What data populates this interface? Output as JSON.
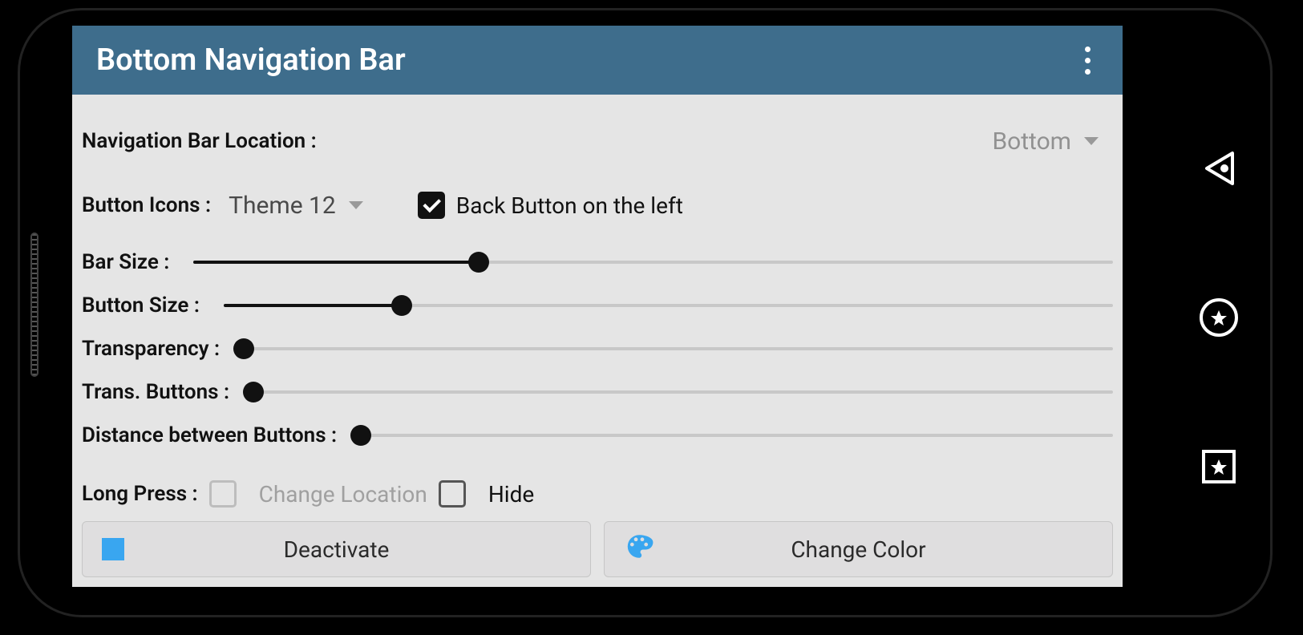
{
  "appBar": {
    "title": "Bottom Navigation Bar"
  },
  "navLocation": {
    "label": "Navigation Bar Location :",
    "value": "Bottom"
  },
  "buttonIcons": {
    "label": "Button Icons :",
    "theme": "Theme 12",
    "backLeftLabel": "Back Button on the left",
    "backLeftChecked": true
  },
  "sliders": {
    "barSize": {
      "label": "Bar Size :",
      "value": 31
    },
    "buttonSize": {
      "label": "Button Size :",
      "value": 20
    },
    "transparency": {
      "label": "Transparency :",
      "value": 0
    },
    "transButtons": {
      "label": "Trans. Buttons :",
      "value": 0
    },
    "distance": {
      "label": "Distance between Buttons :",
      "value": 0
    }
  },
  "longPress": {
    "label": "Long Press :",
    "changeLocation": "Change Location",
    "changeLocationChecked": false,
    "changeLocationDisabled": true,
    "hide": "Hide",
    "hideChecked": false
  },
  "buttons": {
    "deactivate": "Deactivate",
    "changeColor": "Change Color"
  },
  "colors": {
    "accent": "#39a6f0",
    "appbar": "#3e6d8c"
  }
}
